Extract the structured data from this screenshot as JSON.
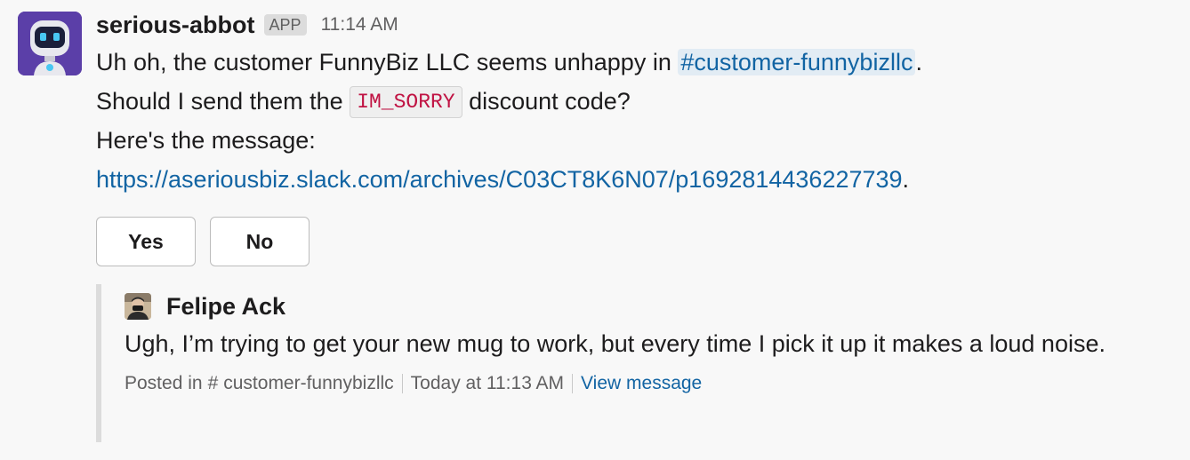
{
  "message": {
    "username": "serious-abbot",
    "badge": "APP",
    "time": "11:14 AM",
    "line1_before": "Uh oh, the customer FunnyBiz LLC seems unhappy in ",
    "line1_channel": "#customer-funnybizllc",
    "line1_after": ".",
    "line2_before": "Should I send them the ",
    "line2_code": "IM_SORRY",
    "line2_after": " discount code?",
    "line3": "Here's the message:",
    "link": "https://aseriousbiz.slack.com/archives/C03CT8K6N07/p1692814436227739",
    "link_after": "."
  },
  "buttons": {
    "yes": "Yes",
    "no": "No"
  },
  "quote": {
    "author": "Felipe Ack",
    "text": "Ugh, I’m trying to get your new mug to work, but every time I pick it up it makes a loud noise.",
    "posted_in": "Posted in",
    "hash": "#",
    "channel": "customer-funnybizllc",
    "time": "Today at 11:13 AM",
    "view": "View message"
  },
  "colors": {
    "link": "#1264a3",
    "code": "#c01343",
    "avatar_bg": "#5b3fa8"
  }
}
